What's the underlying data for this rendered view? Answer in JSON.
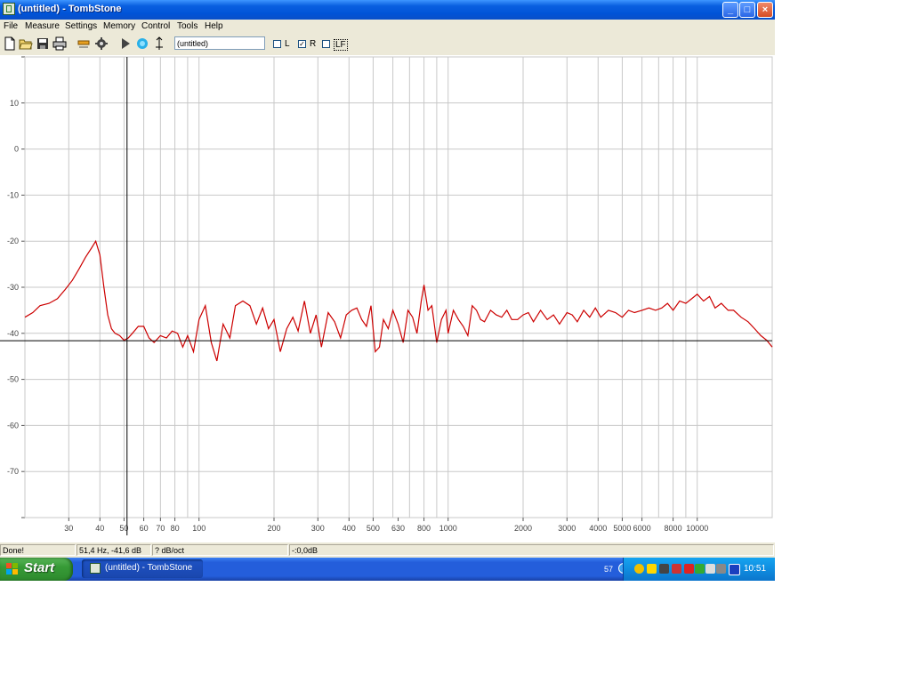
{
  "window": {
    "title": "(untitled) - TombStone",
    "caption_buttons": {
      "minimize": "_",
      "maximize": "□",
      "close": "×"
    }
  },
  "menubar": {
    "items": [
      {
        "label": "File"
      },
      {
        "label": "Measure"
      },
      {
        "label": "Settings"
      },
      {
        "label": "Memory"
      },
      {
        "label": "Control"
      },
      {
        "label": "Tools"
      },
      {
        "label": "Help"
      }
    ]
  },
  "toolbar": {
    "icons": [
      "new-file-icon",
      "open-folder-icon",
      "save-icon",
      "print-icon",
      "signal-generator-icon",
      "settings-icon",
      "play-icon",
      "calibrate-icon",
      "cursor-move-icon"
    ],
    "name_field_value": "(untitled)",
    "channels": [
      {
        "label": "L",
        "checked": false
      },
      {
        "label": "R",
        "checked": true
      },
      {
        "label": "LF",
        "checked": false
      }
    ]
  },
  "chart_data": {
    "type": "line",
    "title": "",
    "xlabel": "",
    "ylabel": "",
    "x_scale": "log",
    "xlim": [
      20,
      20000
    ],
    "ylim": [
      -80,
      20
    ],
    "grid": true,
    "x_tick_labels": [
      {
        "value": 30,
        "label": "30"
      },
      {
        "value": 40,
        "label": "40"
      },
      {
        "value": 50,
        "label": "50"
      },
      {
        "value": 60,
        "label": "60"
      },
      {
        "value": 70,
        "label": "70"
      },
      {
        "value": 80,
        "label": "80"
      },
      {
        "value": 100,
        "label": "100"
      },
      {
        "value": 200,
        "label": "200"
      },
      {
        "value": 300,
        "label": "300"
      },
      {
        "value": 400,
        "label": "400"
      },
      {
        "value": 500,
        "label": "500"
      },
      {
        "value": 630,
        "label": "630"
      },
      {
        "value": 800,
        "label": "800"
      },
      {
        "value": 1000,
        "label": "1000"
      },
      {
        "value": 2000,
        "label": "2000"
      },
      {
        "value": 3000,
        "label": "3000"
      },
      {
        "value": 4000,
        "label": "4000"
      },
      {
        "value": 5000,
        "label": "5000"
      },
      {
        "value": 6000,
        "label": "6000"
      },
      {
        "value": 8000,
        "label": "8000"
      },
      {
        "value": 10000,
        "label": "10000"
      }
    ],
    "y_tick_labels": [
      {
        "value": 10,
        "label": "10"
      },
      {
        "value": 0,
        "label": "0"
      },
      {
        "value": -10,
        "label": "-10"
      },
      {
        "value": -20,
        "label": "-20"
      },
      {
        "value": -30,
        "label": "-30"
      },
      {
        "value": -40,
        "label": "-40"
      },
      {
        "value": -50,
        "label": "-50"
      },
      {
        "value": -60,
        "label": "-60"
      },
      {
        "value": -70,
        "label": "-70"
      }
    ],
    "cursor": {
      "x": 51.4,
      "y": -41.6
    },
    "series": [
      {
        "color": "#cc0000",
        "x": [
          20,
          21.5,
          23,
          25,
          27,
          29,
          31,
          33,
          35,
          37,
          38.5,
          40,
          41.5,
          43,
          44.5,
          46,
          48,
          50,
          52,
          54,
          57,
          60,
          63,
          66,
          70,
          74,
          78,
          82,
          86,
          90,
          95,
          100,
          106,
          112,
          118,
          125,
          133,
          140,
          150,
          160,
          170,
          180,
          190,
          200,
          212,
          225,
          238,
          250,
          265,
          280,
          295,
          310,
          330,
          350,
          370,
          390,
          410,
          430,
          450,
          470,
          490,
          510,
          530,
          550,
          575,
          600,
          630,
          660,
          690,
          720,
          750,
          780,
          800,
          830,
          860,
          900,
          940,
          980,
          1000,
          1050,
          1100,
          1150,
          1200,
          1250,
          1300,
          1350,
          1400,
          1480,
          1560,
          1640,
          1720,
          1800,
          1900,
          2000,
          2100,
          2200,
          2350,
          2500,
          2650,
          2800,
          3000,
          3150,
          3300,
          3500,
          3700,
          3900,
          4100,
          4400,
          4700,
          5000,
          5300,
          5600,
          6000,
          6400,
          6800,
          7200,
          7600,
          8000,
          8500,
          9000,
          9500,
          10000,
          10600,
          11200,
          11800,
          12500,
          13300,
          14000,
          15000,
          16000,
          17000,
          18000,
          19000,
          20000
        ],
        "values": [
          -36.5,
          -35.5,
          -34,
          -33.5,
          -32.5,
          -30.5,
          -28.5,
          -26,
          -23.5,
          -21.5,
          -20,
          -23,
          -30,
          -36,
          -39,
          -40,
          -40.5,
          -41.5,
          -41,
          -40,
          -38.5,
          -38.5,
          -41,
          -42,
          -40.5,
          -41,
          -39.5,
          -40,
          -43,
          -40.5,
          -44,
          -37,
          -34,
          -42,
          -46,
          -38,
          -41,
          -34,
          -33,
          -34,
          -38,
          -34.5,
          -39,
          -37,
          -44,
          -39,
          -36.5,
          -39.5,
          -33,
          -40,
          -36,
          -43,
          -35.5,
          -37.5,
          -41,
          -36,
          -35,
          -34.5,
          -37,
          -38.5,
          -34,
          -44,
          -43,
          -37,
          -39,
          -35,
          -38,
          -42,
          -35,
          -36.5,
          -40,
          -33,
          -29.5,
          -35,
          -34,
          -42,
          -37,
          -35,
          -40,
          -35,
          -37,
          -38.5,
          -40.5,
          -34,
          -35,
          -37,
          -37.5,
          -35,
          -36,
          -36.5,
          -35,
          -37,
          -37,
          -36,
          -35.5,
          -37.5,
          -35,
          -37,
          -36,
          -38,
          -35.5,
          -36,
          -37.5,
          -35,
          -36.5,
          -34.5,
          -36.5,
          -35,
          -35.5,
          -36.5,
          -35,
          -35.5,
          -35,
          -34.5,
          -35,
          -34.5,
          -33.5,
          -35,
          -33,
          -33.5,
          -32.5,
          -31.5,
          -33,
          -32,
          -34.5,
          -33.5,
          -35,
          -35,
          -36.5,
          -37.5,
          -39,
          -40.5,
          -41.5,
          -43
        ]
      }
    ]
  },
  "statusbar": {
    "status": "Done!",
    "cursor_readout": "51,4 Hz, -41,6 dB",
    "smoothing": "? dB/oct",
    "level": "-:0,0dB"
  },
  "taskbar": {
    "start_label": "Start",
    "task_label": "(untitled) - TombStone",
    "tray_number": "57",
    "clock": "10:51"
  }
}
